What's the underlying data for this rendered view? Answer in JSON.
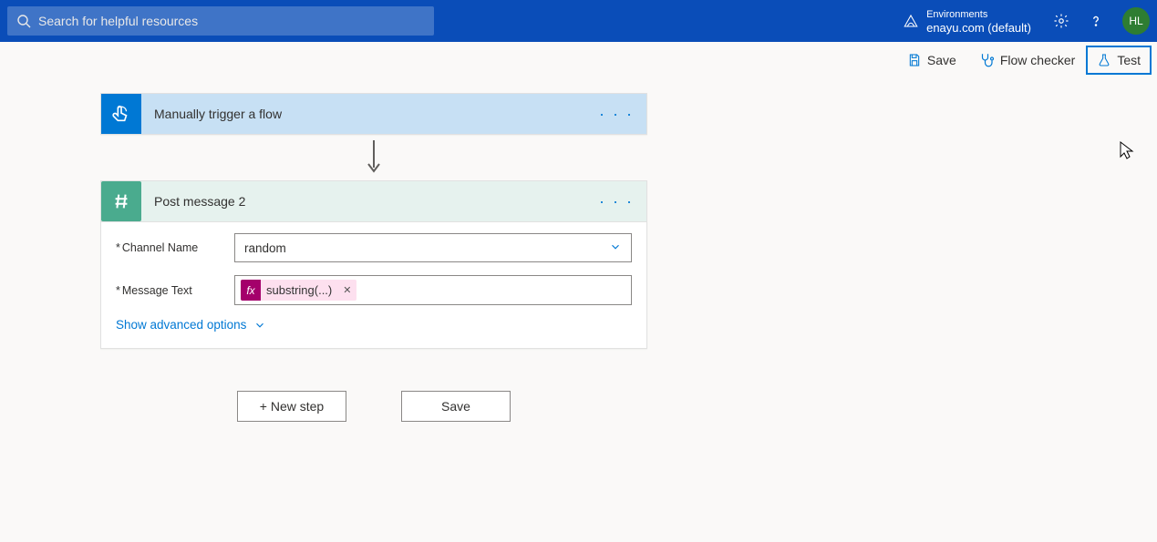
{
  "header": {
    "search_placeholder": "Search for helpful resources",
    "env_label": "Environments",
    "env_name": "enayu.com (default)",
    "user_initials": "HL"
  },
  "toolbar": {
    "save": "Save",
    "flow_checker": "Flow checker",
    "test": "Test"
  },
  "trigger": {
    "title": "Manually trigger a flow"
  },
  "action": {
    "title": "Post message 2",
    "channel_label": "Channel Name",
    "channel_value": "random",
    "message_label": "Message Text",
    "token_fx": "fx",
    "token_label": "substring(...)",
    "advanced": "Show advanced options"
  },
  "buttons": {
    "new_step": "+ New step",
    "save": "Save"
  }
}
